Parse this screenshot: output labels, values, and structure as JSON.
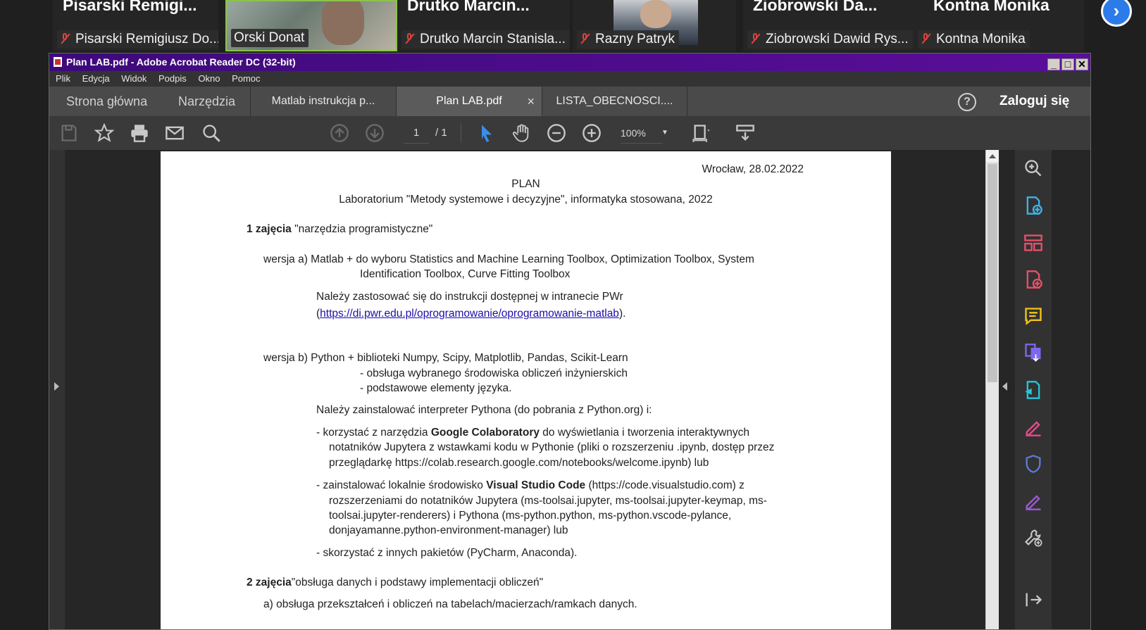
{
  "meeting": {
    "tiles": [
      {
        "big": "Pisarski  Remigi...",
        "label": "Pisarski Remigiusz Do...",
        "muted": true
      },
      {
        "big": "",
        "label": "Orski Donat",
        "muted": false
      },
      {
        "big": "Drutko  Marcin...",
        "label": "Drutko Marcin Stanisla...",
        "muted": true
      },
      {
        "big": "",
        "label": "Razny Patryk",
        "muted": true
      },
      {
        "big": "Ziobrowski  Da...",
        "label": "Ziobrowski Dawid Rys...",
        "muted": true
      },
      {
        "big": "Kontna Monika",
        "label": "Kontna Monika",
        "muted": true
      }
    ],
    "next_label": "›"
  },
  "window": {
    "title": "Plan LAB.pdf - Adobe Acrobat Reader DC (32-bit)",
    "controls": {
      "minimize": "_",
      "maximize": "□",
      "close": "✕"
    }
  },
  "menu": [
    "Plik",
    "Edycja",
    "Widok",
    "Podpis",
    "Okno",
    "Pomoc"
  ],
  "tabs": {
    "home": "Strona główna",
    "tools": "Narzędzia",
    "documents": [
      {
        "label": "Matlab instrukcja p...",
        "active": false
      },
      {
        "label": "Plan LAB.pdf",
        "active": true,
        "close": "×"
      },
      {
        "label": "LISTA_OBECNOSCI....",
        "active": false
      }
    ],
    "help": "?",
    "login": "Zaloguj się"
  },
  "toolbar": {
    "page_current": "1",
    "page_total": "/ 1",
    "zoom": "100%",
    "accent": "#3b8de8"
  },
  "document": {
    "date": "Wrocław, 28.02.2022",
    "heading": "PLAN",
    "subtitle": "Laboratorium \"Metody systemowe i decyzyjne\", informatyka stosowana, 2022",
    "s1_label": "1 zajęcia",
    "s1_title": " \"narzędzia programistyczne\"",
    "va_line1": "wersja a)  Matlab  +  do  wyboru  Statistics  and  Machine  Learning  Toolbox,  Optimization  Toolbox,  System",
    "va_line2": "Identification Toolbox, Curve Fitting Toolbox",
    "va_note1": "Należy zastosować się do instrukcji dostępnej w intranecie PWr",
    "va_note2_open": "(",
    "va_link": "https://di.pwr.edu.pl/oprogramowanie/oprogramowanie-matlab",
    "va_note2_close": ").",
    "vb_line1": "wersja b)  Python + biblioteki Numpy, Scipy, Matplotlib, Pandas, Scikit-Learn",
    "vb_line2": "- obsługa wybranego środowiska obliczeń inżynierskich",
    "vb_line3": "- podstawowe elementy języka.",
    "vb_note": "Należy zainstalować interpreter Pythona (do pobrania z Python.org) i:",
    "b1_pre": "-  korzystać  z  narzędzia  ",
    "b1_bold": "Google Colaboratory",
    "b1_post": "  do  wyświetlania  i  tworzenia  interaktywnych",
    "b1_line2": "notatników Jupytera z wstawkami kodu w Pythonie (pliki o rozszerzeniu .ipynb, dostęp przez",
    "b1_line3": "przeglądarkę  https://colab.research.google.com/notebooks/welcome.ipynb)   lub",
    "b2_pre": "-  zainstalować  lokalnie  środowisko  ",
    "b2_bold": "Visual Studio Code",
    "b2_post": "  (https://code.visualstudio.com)  z",
    "b2_line2": "rozszerzeniami do notatników Jupytera (ms-toolsai.jupyter, ms-toolsai.jupyter-keymap, ms-",
    "b2_line3": "toolsai.jupyter-renderers)   i   Pythona   (ms-python.python,   ms-python.vscode-pylance,",
    "b2_line4": "donjayamanne.python-environment-manager)   lub",
    "b3": "- skorzystać z innych pakietów (PyCharm, Anaconda).",
    "s2_label": "2 zajęcia",
    "s2_title": "\"obsługa danych i podstawy implementacji obliczeń\"",
    "s2_a": "a) obsługa przekształceń i obliczeń na tabelach/macierzach/ramkach danych."
  },
  "right_panel_icons": [
    "search-zoom-icon",
    "create-pdf-icon",
    "organize-pages-icon",
    "export-pdf-icon",
    "comment-icon",
    "combine-files-icon",
    "send-signature-icon",
    "fill-sign-icon",
    "protect-icon",
    "sign-icon",
    "more-tools-icon",
    "expand-panel-icon"
  ],
  "colors": {
    "titlebar": "#4b0082",
    "link": "#1a0dab",
    "muted_mic": "#e0443e",
    "active_tile_border": "#8bc34a"
  }
}
